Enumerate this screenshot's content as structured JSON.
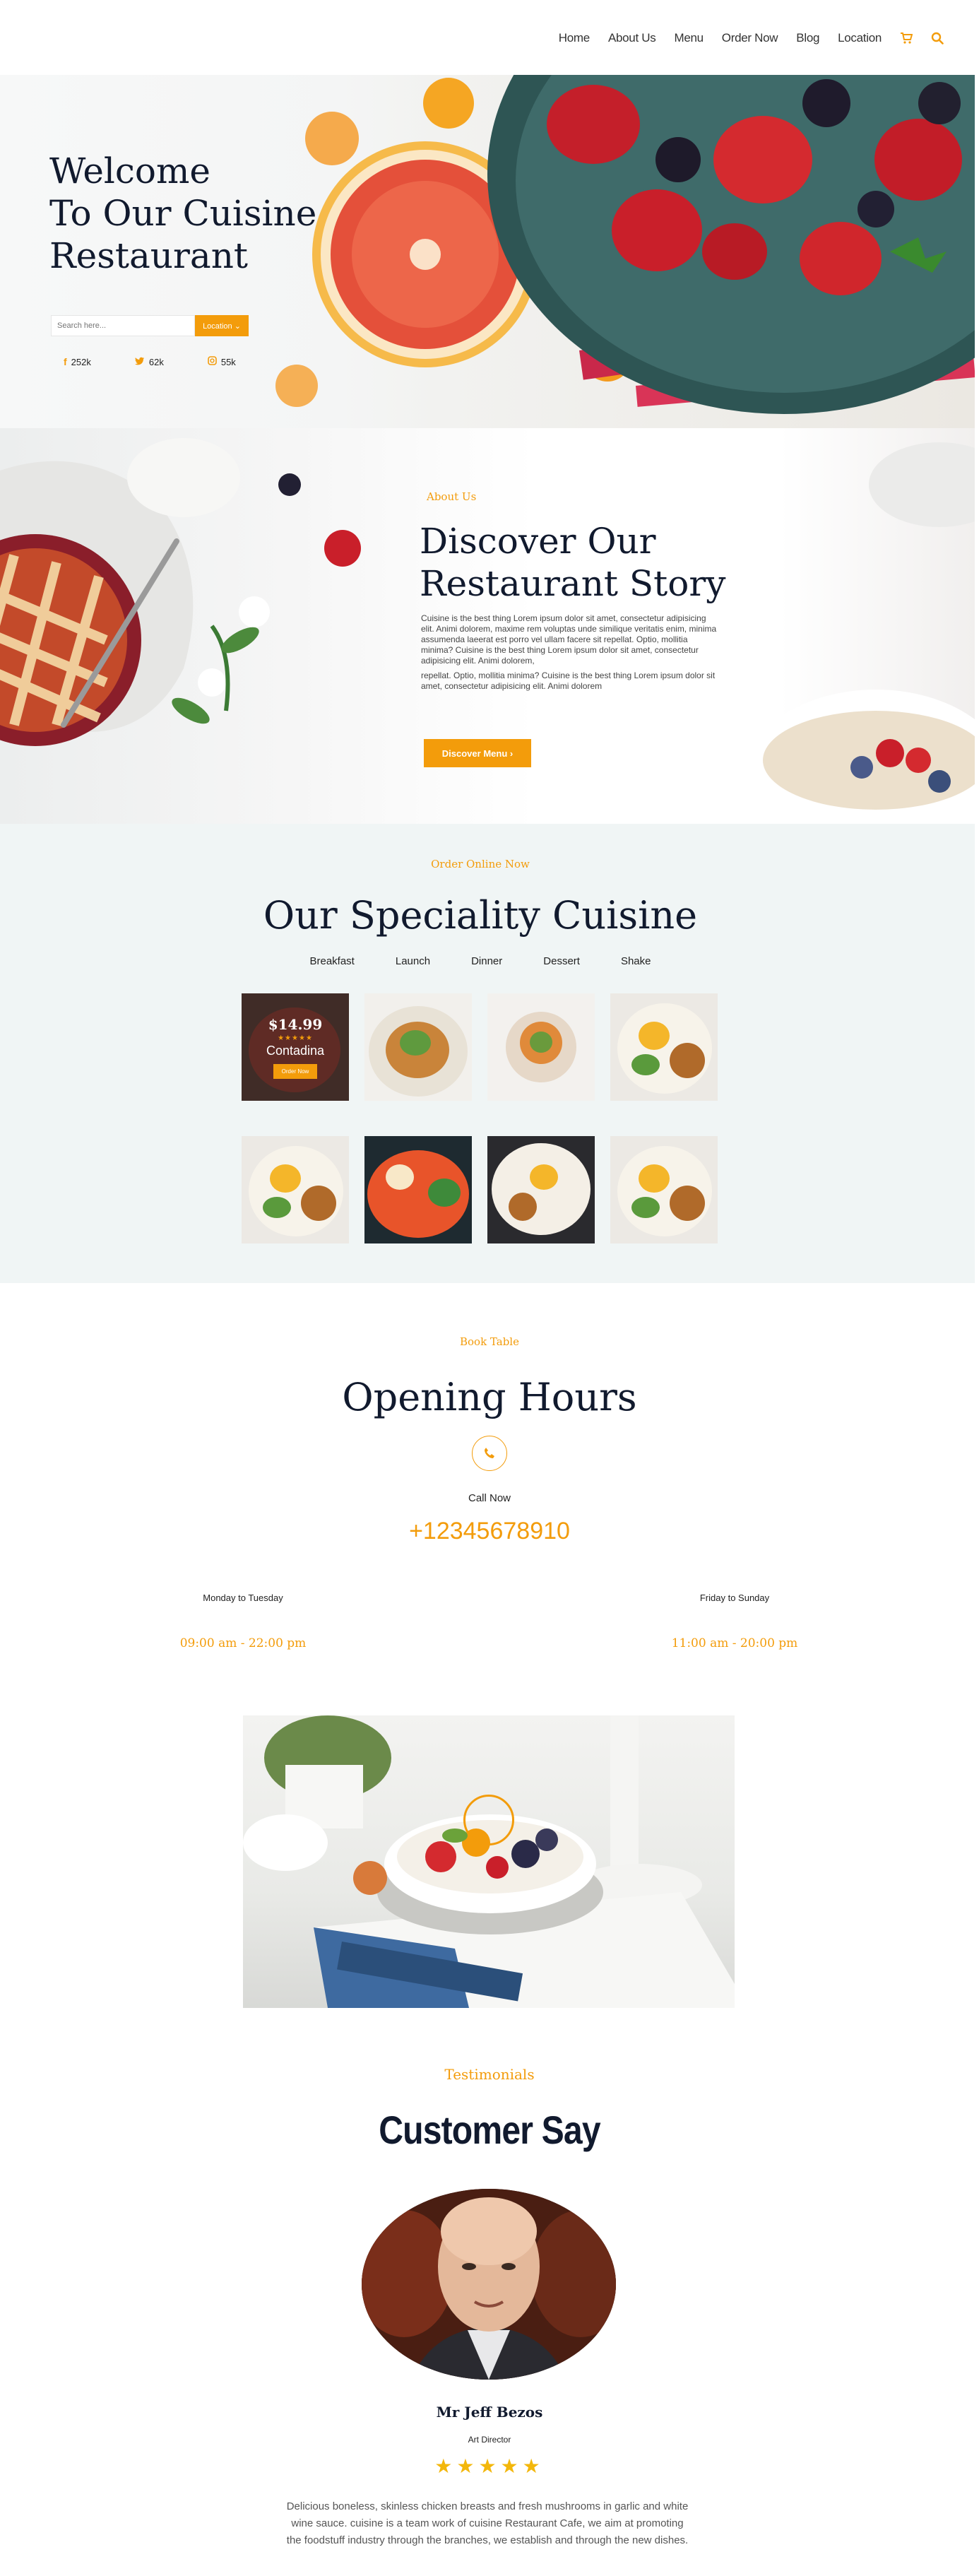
{
  "nav": {
    "links": [
      "Home",
      "About Us",
      "Menu",
      "Order Now",
      "Blog",
      "Location"
    ],
    "icons": [
      "cart-icon",
      "search-icon"
    ],
    "accent": "#f39c0b"
  },
  "hero": {
    "title_line1": "Welcome",
    "title_line2": "To Our Cuisine",
    "title_line3": "Restaurant",
    "search_placeholder": "Search here...",
    "location_button": "Location ⌄",
    "social": [
      {
        "icon": "facebook-icon",
        "count": "252k"
      },
      {
        "icon": "twitter-icon",
        "count": "62k"
      },
      {
        "icon": "instagram-icon",
        "count": "55k"
      }
    ]
  },
  "about": {
    "eyebrow": "About Us",
    "title_line1": "Discover Our",
    "title_line2": "Restaurant Story",
    "paragraph1": "Cuisine is the best thing Lorem ipsum dolor sit amet, consectetur adipisicing elit. Animi dolorem, maxime rem voluptas unde similique veritatis enim, minima assumenda laeerat est porro vel ullam facere sit repellat. Optio, mollitia minima? Cuisine is the best thing Lorem ipsum dolor sit amet, consectetur adipisicing elit. Animi dolorem,",
    "paragraph2": "repellat. Optio, mollitia minima? Cuisine is the best thing Lorem ipsum dolor sit amet, consectetur adipisicing elit. Animi dolorem",
    "button": "Discover Menu ›"
  },
  "speciality": {
    "eyebrow": "Order Online Now",
    "title": "Our Speciality Cuisine",
    "tabs": [
      "Breakfast",
      "Launch",
      "Dinner",
      "Dessert",
      "Shake"
    ],
    "promo": {
      "price": "$14.99",
      "stars": "★★★★★",
      "name": "Contadina",
      "order": "Order Now"
    }
  },
  "book": {
    "eyebrow": "Book Table",
    "title": "Opening Hours",
    "call_label": "Call Now",
    "phone": "+12345678910",
    "days": [
      {
        "label": "Monday to Tuesday",
        "time": "09:00 am - 22:00 pm"
      },
      {
        "label": "Friday to Sunday",
        "time": "11:00 am - 20:00 pm"
      }
    ]
  },
  "testimonials": {
    "eyebrow": "Testimonials",
    "title": "Customer Say",
    "name": "Mr Jeff Bezos",
    "role": "Art Director",
    "rating": 5,
    "stars": "★★★★★",
    "quote": "Delicious boneless, skinless chicken breasts and fresh mushrooms in garlic and white wine sauce. cuisine is a team work of cuisine Restaurant Cafe, we aim at promoting the foodstuff industry through the branches, we establish and through the new dishes.",
    "dots": 5,
    "active_dot": 3
  }
}
